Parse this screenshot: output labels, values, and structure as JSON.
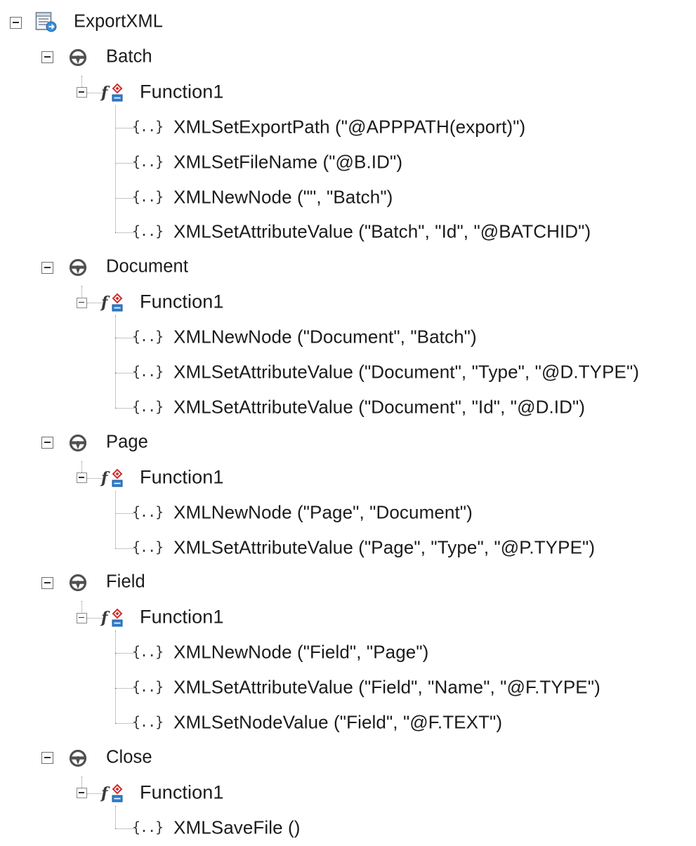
{
  "tree": {
    "root": {
      "label": "ExportXML",
      "icon": "export-document-icon"
    },
    "events": [
      {
        "label": "Batch",
        "icon": "steering-wheel-icon",
        "function": {
          "label": "Function1",
          "icon": "function-icon",
          "calls": [
            "XMLSetExportPath (\"@APPPATH(export)\")",
            "XMLSetFileName (\"@B.ID\")",
            "XMLNewNode (\"\", \"Batch\")",
            "XMLSetAttributeValue (\"Batch\", \"Id\", \"@BATCHID\")"
          ]
        }
      },
      {
        "label": "Document",
        "icon": "steering-wheel-icon",
        "function": {
          "label": "Function1",
          "icon": "function-icon",
          "calls": [
            "XMLNewNode (\"Document\", \"Batch\")",
            "XMLSetAttributeValue (\"Document\", \"Type\", \"@D.TYPE\")",
            "XMLSetAttributeValue (\"Document\", \"Id\", \"@D.ID\")"
          ]
        }
      },
      {
        "label": "Page",
        "icon": "steering-wheel-icon",
        "function": {
          "label": "Function1",
          "icon": "function-icon",
          "calls": [
            "XMLNewNode (\"Page\", \"Document\")",
            "XMLSetAttributeValue (\"Page\", \"Type\", \"@P.TYPE\")"
          ]
        }
      },
      {
        "label": "Field",
        "icon": "steering-wheel-icon",
        "function": {
          "label": "Function1",
          "icon": "function-icon",
          "calls": [
            "XMLNewNode (\"Field\", \"Page\")",
            "XMLSetAttributeValue (\"Field\", \"Name\", \"@F.TYPE\")",
            "XMLSetNodeValue (\"Field\", \"@F.TEXT\")"
          ]
        }
      },
      {
        "label": "Close",
        "icon": "steering-wheel-icon",
        "function": {
          "label": "Function1",
          "icon": "function-icon",
          "calls": [
            "XMLSaveFile ()"
          ]
        }
      }
    ],
    "call_icon_glyph": "{..}"
  }
}
